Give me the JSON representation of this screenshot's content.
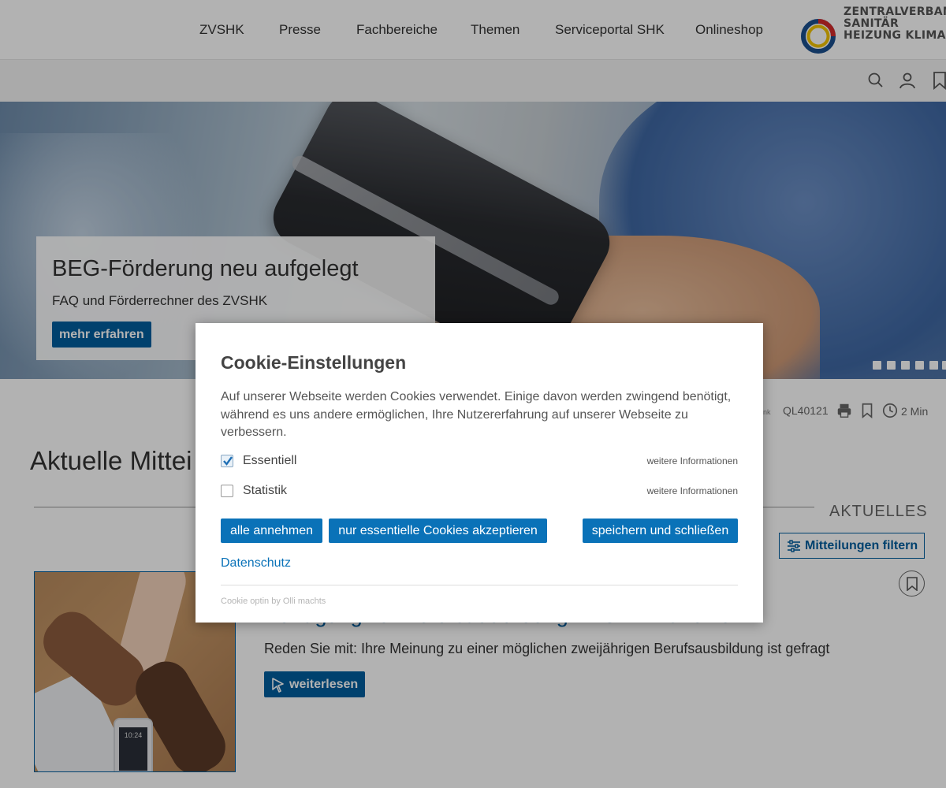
{
  "header": {
    "nav": [
      "ZVSHK",
      "Presse",
      "Fachbereiche",
      "Themen",
      "Serviceportal SHK",
      "Onlineshop"
    ],
    "logo_lines": [
      "ZENTRALVERBAND",
      "SANITÄR",
      "HEIZUNG KLIMA"
    ]
  },
  "toolbar": {
    "icons": [
      "search-icon",
      "user-icon",
      "bookmark-icon"
    ]
  },
  "hero": {
    "title": "BEG-Förderung neu aufgelegt",
    "subtitle": "FAQ und Förderrechner des ZVSHK",
    "button": "mehr erfahren",
    "slide_count": 6
  },
  "meta": {
    "quicklink_label": "Quicklink",
    "quicklink_visible": "cklink",
    "quicklink_code": "QL40121",
    "reading_time": "2 Min"
  },
  "page": {
    "title": "Aktuelle Mittei",
    "section_label": "AKTUELLES",
    "filter_button": "Mitteilungen filtern"
  },
  "article": {
    "title": "Befragung zur Berufsausbildung im SHK-Handwerk",
    "text": "Reden Sie mit: Ihre Meinung zu einer möglichen zweijährigen Berufsausbildung ist gefragt",
    "button": "weiterlesen",
    "image_phone_time": "10:24"
  },
  "cookie_modal": {
    "title": "Cookie-Einstellungen",
    "text": "Auf unserer Webseite werden Cookies verwendet. Einige davon werden zwingend benötigt, während es uns andere ermöglichen, Ihre Nutzererfahrung auf unserer Webseite zu verbessern.",
    "options": [
      {
        "label": "Essentiell",
        "checked": true,
        "more": "weitere Informationen"
      },
      {
        "label": "Statistik",
        "checked": false,
        "more": "weitere Informationen"
      }
    ],
    "buttons": {
      "accept_all": "alle annehmen",
      "essential_only": "nur essentielle Cookies akzeptieren",
      "save_close": "speichern und schließen"
    },
    "privacy_link": "Datenschutz",
    "credit": "Cookie optin by Olli machts"
  },
  "colors": {
    "primary": "#005e9e",
    "modal_button": "#0a72b8",
    "overlay": "rgba(0,0,0,0.30)"
  }
}
